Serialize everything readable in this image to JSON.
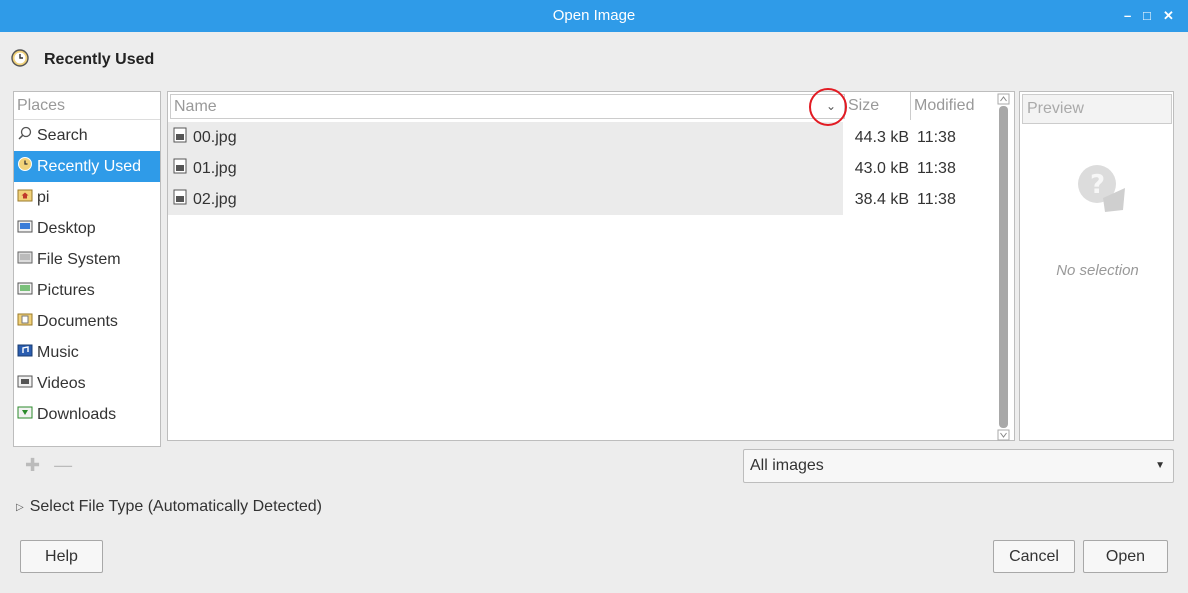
{
  "window": {
    "title": "Open Image"
  },
  "location": {
    "label": "Recently Used"
  },
  "places": {
    "header": "Places",
    "items": [
      {
        "label": "Search",
        "icon": "search-icon"
      },
      {
        "label": "Recently Used",
        "icon": "clock-icon",
        "selected": true
      },
      {
        "label": "pi",
        "icon": "home-folder-icon"
      },
      {
        "label": "Desktop",
        "icon": "desktop-folder-icon"
      },
      {
        "label": "File System",
        "icon": "drive-icon"
      },
      {
        "label": "Pictures",
        "icon": "pictures-folder-icon"
      },
      {
        "label": "Documents",
        "icon": "documents-folder-icon"
      },
      {
        "label": "Music",
        "icon": "music-folder-icon"
      },
      {
        "label": "Videos",
        "icon": "videos-folder-icon"
      },
      {
        "label": "Downloads",
        "icon": "downloads-folder-icon"
      }
    ]
  },
  "files": {
    "columns": {
      "name": "Name",
      "size": "Size",
      "modified": "Modified"
    },
    "rows": [
      {
        "name": "00.jpg",
        "size": "44.3 kB",
        "modified": "11:38"
      },
      {
        "name": "01.jpg",
        "size": "43.0 kB",
        "modified": "11:38"
      },
      {
        "name": "02.jpg",
        "size": "38.4 kB",
        "modified": "11:38"
      }
    ]
  },
  "preview": {
    "button": "Preview",
    "empty": "No selection"
  },
  "filter": {
    "selected": "All images"
  },
  "filetype": {
    "label": "Select File Type (Automatically Detected)"
  },
  "buttons": {
    "help": "Help",
    "cancel": "Cancel",
    "open": "Open"
  },
  "colors": {
    "accent": "#2f9be8",
    "marker": "#e21b23"
  }
}
